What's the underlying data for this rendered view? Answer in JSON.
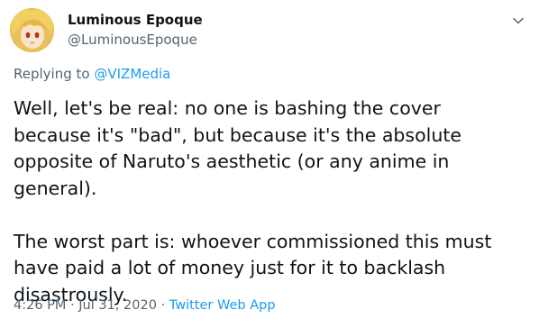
{
  "author": {
    "display_name": "Luminous Epoque",
    "handle": "@LuminousEpoque",
    "avatar_icon": "anime-avatar-icon"
  },
  "reply": {
    "prefix": "Replying to",
    "mention": "@VIZMedia"
  },
  "tweet": {
    "paragraph1": "Well, let's be real: no one is bashing the cover because it's \"bad\", but because it's the absolute opposite of Naruto's aesthetic (or any anime in general).",
    "paragraph2": "The worst part is: whoever commissioned this must have paid a lot of money just for it to backlash disastrously."
  },
  "meta": {
    "time": "4:26 PM",
    "separator1": "·",
    "date": "Jul 31, 2020",
    "separator2": "·",
    "source": "Twitter Web App"
  },
  "colors": {
    "text": "#0f1419",
    "secondary": "#536471",
    "link": "#1d9bf0"
  }
}
